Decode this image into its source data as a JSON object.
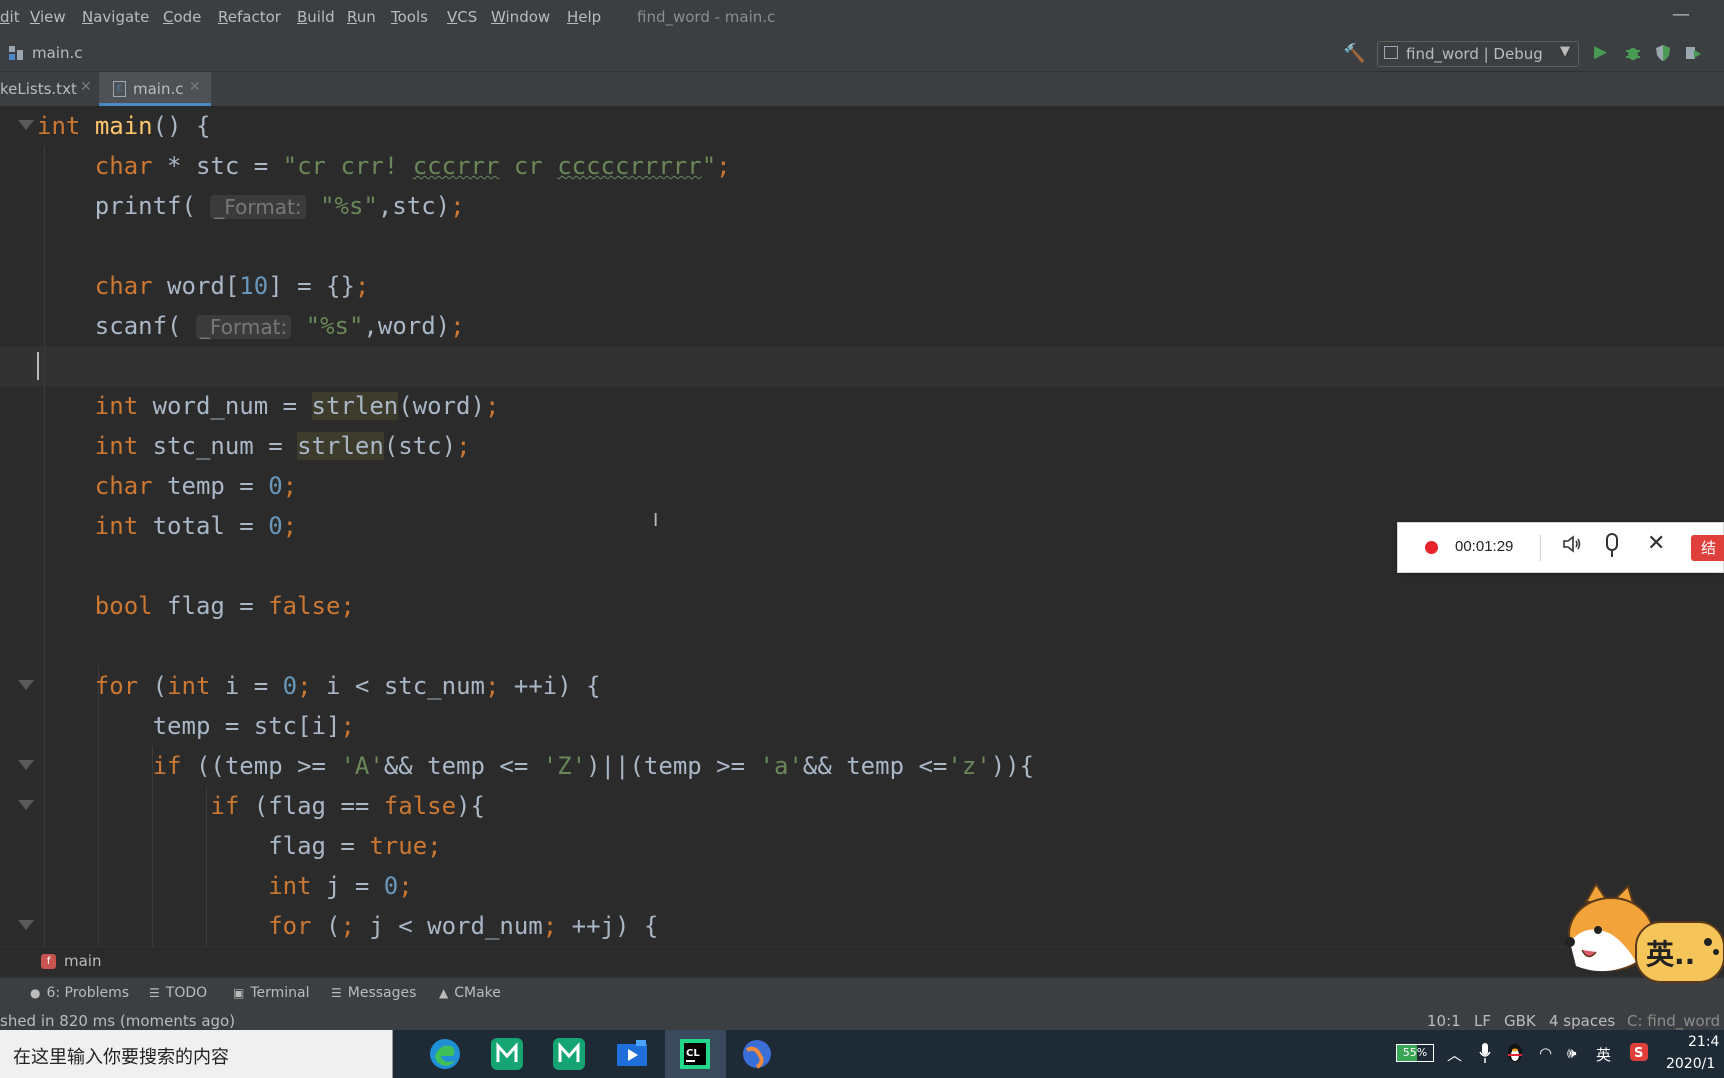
{
  "menu": {
    "items": [
      "dit",
      "View",
      "Navigate",
      "Code",
      "Refactor",
      "Build",
      "Run",
      "Tools",
      "VCS",
      "Window",
      "Help"
    ],
    "window_title": "find_word - main.c",
    "minimize_icon": "minimize-icon"
  },
  "navbar": {
    "crumb_file": "main.c",
    "run_config": "find_word | Debug"
  },
  "tabs": [
    {
      "label": "keLists.txt",
      "active": false
    },
    {
      "label": "main.c",
      "active": true
    }
  ],
  "editor": {
    "colors": {
      "keyword": "#cc7832",
      "string": "#6a8759",
      "number": "#6897bb",
      "function": "#ffc66d",
      "text": "#a9b7c6"
    },
    "hint_label": "_Format:",
    "lines": [
      "int main() {",
      "    char * stc = \"cr crr! cccrrr cr cccccrrrrr\";",
      "    printf( _Format: \"%s\",stc);",
      "",
      "    char word[10] = {};",
      "    scanf( _Format: \"%s\",word);",
      "",
      "    int word_num = strlen(word);",
      "    int stc_num = strlen(stc);",
      "    char temp = 0;",
      "    int total = 0;",
      "",
      "    bool flag = false;",
      "",
      "    for (int i = 0; i < stc_num; ++i) {",
      "        temp = stc[i];",
      "        if ((temp >= 'A'&& temp <= 'Z')||(temp >= 'a'&& temp <='z')){",
      "            if (flag == false){",
      "                flag = true;",
      "                int j = 0;",
      "                for (; j < word_num; ++j) {"
    ],
    "caret_line": 7
  },
  "recorder": {
    "time": "00:01:29",
    "end_label": "结"
  },
  "breadcrumb": {
    "badge": "f",
    "function": "main"
  },
  "tool_windows": [
    {
      "icon": "problems-icon",
      "label": "6: Problems"
    },
    {
      "icon": "todo-icon",
      "label": "TODO"
    },
    {
      "icon": "terminal-icon",
      "label": "Terminal"
    },
    {
      "icon": "messages-icon",
      "label": "Messages"
    },
    {
      "icon": "cmake-icon",
      "label": "CMake"
    }
  ],
  "status": {
    "message": "shed in 820 ms (moments ago)",
    "position": "10:1",
    "line_sep": "LF",
    "encoding": "GBK",
    "indent": "4 spaces",
    "context": "C: find_word"
  },
  "taskbar": {
    "search_placeholder": "在这里输入你要搜索的内容",
    "battery": "55%",
    "battery_level": 0.55,
    "ime": "英",
    "time": "21:4",
    "date": "2020/1"
  },
  "sticker": {
    "text": "英.."
  }
}
